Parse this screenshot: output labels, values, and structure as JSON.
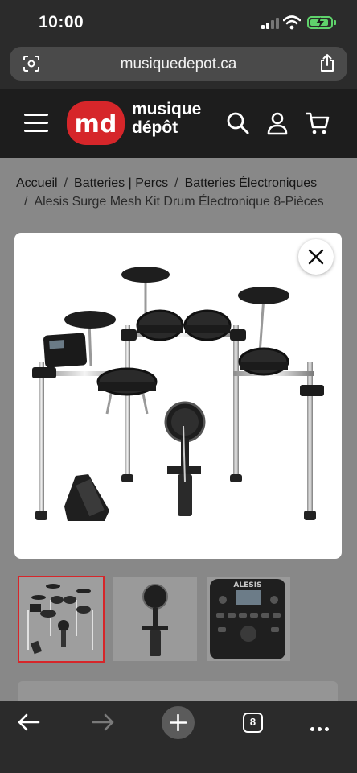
{
  "status_bar": {
    "time": "10:00"
  },
  "browser": {
    "url": "musiquedepot.ca",
    "tab_count": "8"
  },
  "site": {
    "brand": {
      "mark": "md",
      "line1": "musique",
      "line2": "dépôt"
    },
    "accent_color": "#d6262a"
  },
  "breadcrumb": {
    "items": [
      "Accueil",
      "Batteries | Percs",
      "Batteries Électroniques"
    ],
    "current": "Alesis Surge Mesh Kit Drum Électronique 8-Pièces",
    "separator": "/"
  },
  "gallery": {
    "thumbnails": [
      "drum-kit-full",
      "kick-tower-pedal",
      "drum-module"
    ],
    "selected_index": 0,
    "module_brand": "ALESIS"
  }
}
